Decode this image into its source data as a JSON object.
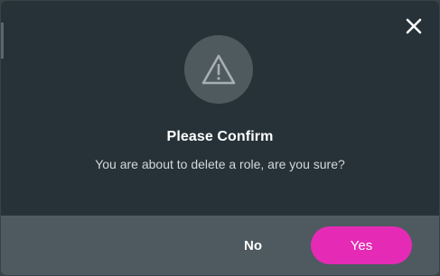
{
  "dialog": {
    "title": "Please Confirm",
    "message": "You are about to delete a role, are you sure?",
    "icon": "warning-triangle-icon",
    "close_icon": "close-icon"
  },
  "buttons": {
    "no_label": "No",
    "yes_label": "Yes"
  },
  "colors": {
    "dialog_background": "#263238",
    "footer_background": "#4e5a60",
    "icon_circle": "#4f5a5f",
    "primary_button": "#e52bb5",
    "text_primary": "#ffffff",
    "text_secondary": "#d3d8da"
  }
}
